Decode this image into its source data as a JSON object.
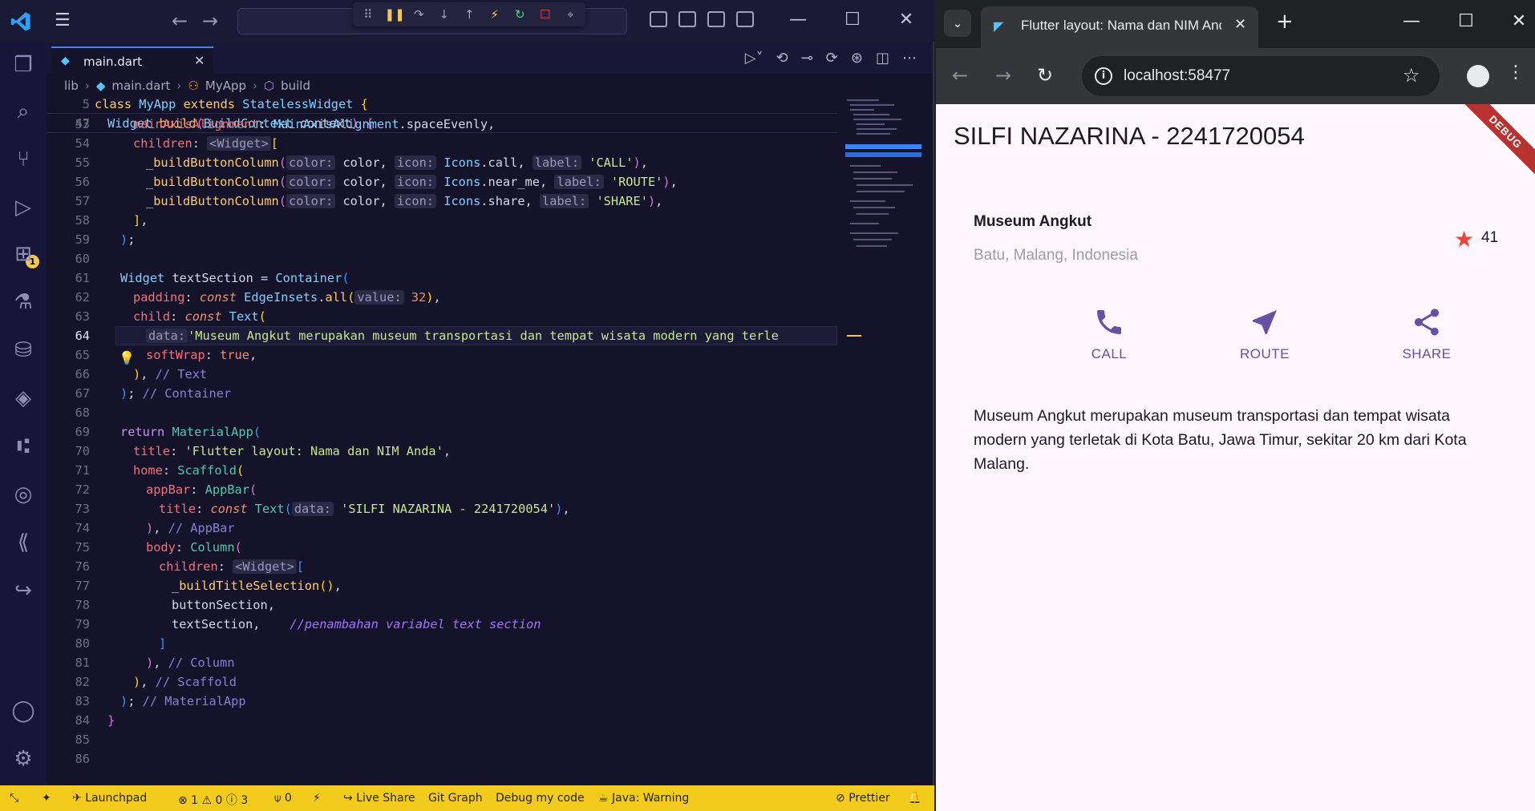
{
  "vscode": {
    "tab": {
      "label": "main.dart"
    },
    "breadcrumb": [
      "lib",
      "main.dart",
      "MyApp",
      "build"
    ],
    "debug_badge": "1",
    "code_lines": [
      {
        "n": "5",
        "sticky": true
      },
      {
        "n": "47",
        "sticky": true
      },
      {
        "n": "53"
      },
      {
        "n": "54"
      },
      {
        "n": "55"
      },
      {
        "n": "56"
      },
      {
        "n": "57"
      },
      {
        "n": "58"
      },
      {
        "n": "59"
      },
      {
        "n": "60"
      },
      {
        "n": "61"
      },
      {
        "n": "62"
      },
      {
        "n": "63"
      },
      {
        "n": "64",
        "active": true
      },
      {
        "n": "65"
      },
      {
        "n": "66"
      },
      {
        "n": "67"
      },
      {
        "n": "68"
      },
      {
        "n": "69"
      },
      {
        "n": "70"
      },
      {
        "n": "71"
      },
      {
        "n": "72"
      },
      {
        "n": "73"
      },
      {
        "n": "74"
      },
      {
        "n": "75"
      },
      {
        "n": "76"
      },
      {
        "n": "77"
      },
      {
        "n": "78"
      },
      {
        "n": "79"
      },
      {
        "n": "80"
      },
      {
        "n": "81"
      },
      {
        "n": "82"
      },
      {
        "n": "83"
      },
      {
        "n": "84"
      },
      {
        "n": "85"
      },
      {
        "n": "86"
      }
    ],
    "status": {
      "launchpad": "Launchpad",
      "problems": "⊗ 1 ⚠ 0 ⓘ 3",
      "ports": "0",
      "live_share": "Live Share",
      "git_graph": "Git Graph",
      "debug": "Debug my code",
      "java": "Java: Warning",
      "prettier": "Prettier"
    }
  },
  "chrome": {
    "tab_title": "Flutter layout: Nama dan NIM Anda",
    "url": "localhost:58477",
    "debug_banner": "DEBUG"
  },
  "app": {
    "appbar_title": "SILFI NAZARINA - 2241720054",
    "place_name": "Museum Angkut",
    "place_location": "Batu, Malang, Indonesia",
    "star_count": "41",
    "buttons": [
      {
        "label": "CALL",
        "icon": "phone-icon"
      },
      {
        "label": "ROUTE",
        "icon": "near-me-icon"
      },
      {
        "label": "SHARE",
        "icon": "share-icon"
      }
    ],
    "description": "Museum Angkut merupakan museum transportasi dan tempat wisata modern yang terletak di Kota Batu, Jawa Timur, sekitar 20 km dari Kota Malang.",
    "accent_color": "#6750a4",
    "star_color": "#f44336"
  }
}
